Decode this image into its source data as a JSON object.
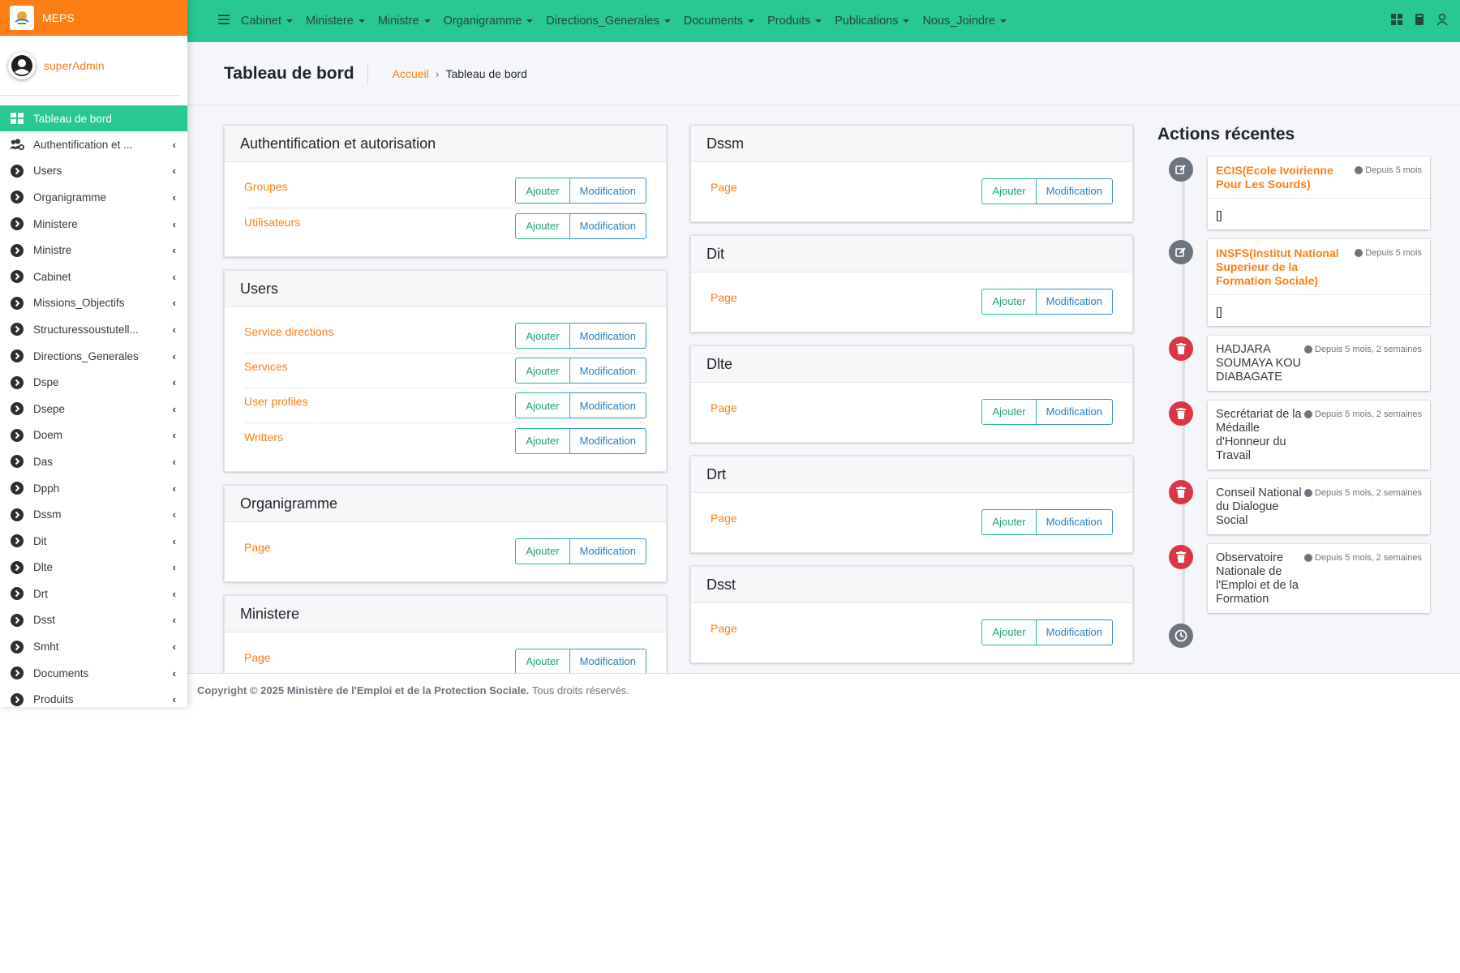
{
  "brand": {
    "name": "MEPS"
  },
  "user": {
    "name": "superAdmin"
  },
  "sidebar": {
    "items": [
      {
        "label": "Tableau de bord",
        "icon": "dashboard-icon",
        "active": true,
        "chevron": false
      },
      {
        "label": "Authentification et ...",
        "icon": "users-cog-icon",
        "chevron": true
      },
      {
        "label": "Users",
        "icon": "chevron-circle-right-icon",
        "chevron": true
      },
      {
        "label": "Organigramme",
        "icon": "chevron-circle-right-icon",
        "chevron": true
      },
      {
        "label": "Ministere",
        "icon": "chevron-circle-right-icon",
        "chevron": true
      },
      {
        "label": "Ministre",
        "icon": "chevron-circle-right-icon",
        "chevron": true
      },
      {
        "label": "Cabinet",
        "icon": "chevron-circle-right-icon",
        "chevron": true
      },
      {
        "label": "Missions_Objectifs",
        "icon": "chevron-circle-right-icon",
        "chevron": true
      },
      {
        "label": "Structuressoustutell...",
        "icon": "chevron-circle-right-icon",
        "chevron": true
      },
      {
        "label": "Directions_Generales",
        "icon": "chevron-circle-right-icon",
        "chevron": true
      },
      {
        "label": "Dspe",
        "icon": "chevron-circle-right-icon",
        "chevron": true
      },
      {
        "label": "Dsepe",
        "icon": "chevron-circle-right-icon",
        "chevron": true
      },
      {
        "label": "Doem",
        "icon": "chevron-circle-right-icon",
        "chevron": true
      },
      {
        "label": "Das",
        "icon": "chevron-circle-right-icon",
        "chevron": true
      },
      {
        "label": "Dpph",
        "icon": "chevron-circle-right-icon",
        "chevron": true
      },
      {
        "label": "Dssm",
        "icon": "chevron-circle-right-icon",
        "chevron": true
      },
      {
        "label": "Dit",
        "icon": "chevron-circle-right-icon",
        "chevron": true
      },
      {
        "label": "Dlte",
        "icon": "chevron-circle-right-icon",
        "chevron": true
      },
      {
        "label": "Drt",
        "icon": "chevron-circle-right-icon",
        "chevron": true
      },
      {
        "label": "Dsst",
        "icon": "chevron-circle-right-icon",
        "chevron": true
      },
      {
        "label": "Smht",
        "icon": "chevron-circle-right-icon",
        "chevron": true
      },
      {
        "label": "Documents",
        "icon": "chevron-circle-right-icon",
        "chevron": true
      },
      {
        "label": "Produits",
        "icon": "chevron-circle-right-icon",
        "chevron": true
      }
    ]
  },
  "topnav": {
    "items": [
      "Cabinet",
      "Ministere",
      "Ministre",
      "Organigramme",
      "Directions_Generales",
      "Documents",
      "Produits",
      "Publications",
      "Nous_Joindre"
    ]
  },
  "header": {
    "title": "Tableau de bord",
    "breadcrumb_home": "Accueil",
    "breadcrumb_sep": "›",
    "breadcrumb_current": "Tableau de bord"
  },
  "buttons": {
    "add": "Ajouter",
    "modify": "Modification"
  },
  "column1": [
    {
      "title": "Authentification et autorisation",
      "rows": [
        "Groupes",
        "Utilisateurs"
      ]
    },
    {
      "title": "Users",
      "rows": [
        "Service directions",
        "Services",
        "User profiles",
        "Writters"
      ]
    },
    {
      "title": "Organigramme",
      "rows": [
        "Page"
      ]
    },
    {
      "title": "Ministere",
      "rows": [
        "Page"
      ]
    }
  ],
  "column2": [
    {
      "title": "Dssm",
      "rows": [
        "Page"
      ]
    },
    {
      "title": "Dit",
      "rows": [
        "Page"
      ]
    },
    {
      "title": "Dlte",
      "rows": [
        "Page"
      ]
    },
    {
      "title": "Drt",
      "rows": [
        "Page"
      ]
    },
    {
      "title": "Dsst",
      "rows": [
        "Page"
      ]
    }
  ],
  "recent": {
    "title": "Actions récentes",
    "items": [
      {
        "type": "edit",
        "title": "ECIS(Ecole Ivoirienne Pour Les Sourds)",
        "time": "Depuis 5 mois",
        "body": "[]"
      },
      {
        "type": "edit",
        "title": "INSFS(Institut National Superieur de la Formation Sociale)",
        "time": "Depuis 5 mois",
        "body": "[]"
      },
      {
        "type": "delete",
        "title": "HADJARA SOUMAYA KOU DIABAGATE",
        "time": "Depuis 5 mois, 2 semaines",
        "body": null
      },
      {
        "type": "delete",
        "title": "Secrétariat de la Médaille d'Honneur du Travail",
        "time": "Depuis 5 mois, 2 semaines",
        "body": null
      },
      {
        "type": "delete",
        "title": "Conseil National du Dialogue Social",
        "time": "Depuis 5 mois, 2 semaines",
        "body": null
      },
      {
        "type": "delete",
        "title": "Observatoire Nationale de l'Emploi et de la Formation",
        "time": "Depuis 5 mois, 2 semaines",
        "body": null
      }
    ]
  },
  "footer": {
    "copyright": "Copyright © 2025 Ministère de l'Emploi et de la Protection Sociale.",
    "rights": "Tous droits réservés."
  },
  "colors": {
    "accent": "#28c794",
    "brand": "#fd7e14",
    "danger": "#dc3545",
    "muted": "#6c757d"
  }
}
